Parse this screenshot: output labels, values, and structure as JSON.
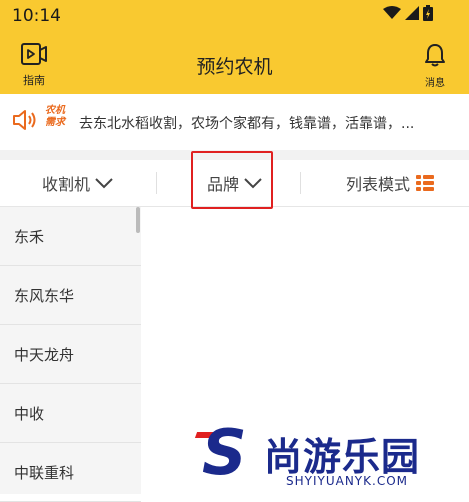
{
  "status_bar": {
    "time": "10:14"
  },
  "header": {
    "guide_label": "指南",
    "title": "预约农机",
    "messages_label": "消息"
  },
  "marquee": {
    "tag_line1": "农机",
    "tag_line2": "需求",
    "text": "去东北水稻收割，农场个家都有，钱靠谱，活靠谱，..."
  },
  "filters": {
    "type_label": "收割机",
    "brand_label": "品牌",
    "view_mode_label": "列表模式"
  },
  "brands": [
    "东禾",
    "东风东华",
    "中天龙舟",
    "中收",
    "中联重科"
  ],
  "watermark": {
    "logo_letter": "S",
    "cn": "尚游乐园",
    "en": "SHYIYUANYK.COM"
  },
  "colors": {
    "header_bg": "#F9C930",
    "accent_orange": "#EA6A1E",
    "highlight_red": "#E02020",
    "watermark_blue": "#1B2A8C"
  },
  "icons": {
    "guide": "video-play-icon",
    "messages": "bell-icon",
    "marquee": "speaker-icon",
    "dropdown": "chevron-down-icon",
    "view_mode": "list-grid-icon"
  }
}
